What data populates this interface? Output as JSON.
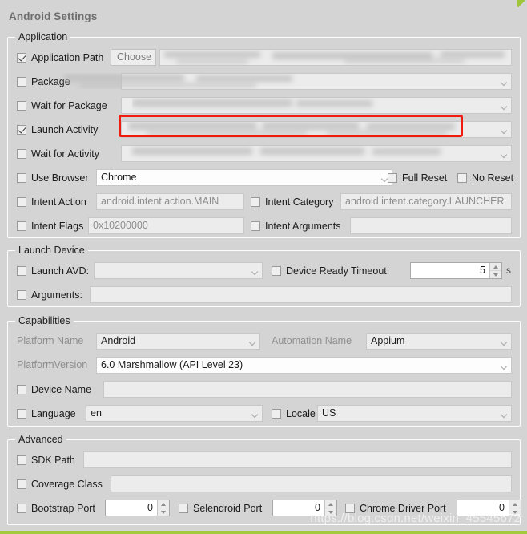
{
  "window": {
    "title": "Android Settings"
  },
  "watermark": "https://blog.csdn.net/weixin_45545672",
  "colors": {
    "background": "#d4d4d4",
    "highlight_border": "#f01c12",
    "accent_green": "#a3c93c",
    "field_background": "#ececec",
    "title_text": "#6e6e6e"
  },
  "groups": {
    "application": {
      "title": "Application",
      "rows": {
        "application_path": {
          "label": "Application Path",
          "checked": true,
          "button_label": "Choose",
          "value": ""
        },
        "package": {
          "label": "Package",
          "checked": false,
          "value": ""
        },
        "wait_for_package": {
          "label": "Wait for Package",
          "checked": false,
          "value": ""
        },
        "launch_activity": {
          "label": "Launch Activity",
          "checked": true,
          "value": "",
          "highlighted": true
        },
        "wait_for_activity": {
          "label": "Wait for Activity",
          "checked": false,
          "value": ""
        },
        "use_browser": {
          "label": "Use Browser",
          "checked": false,
          "value": "Chrome"
        },
        "full_reset": {
          "label": "Full Reset",
          "checked": false
        },
        "no_reset": {
          "label": "No Reset",
          "checked": false
        },
        "intent_action": {
          "label": "Intent Action",
          "checked": false,
          "value": "android.intent.action.MAIN"
        },
        "intent_category": {
          "label": "Intent Category",
          "checked": false,
          "value": "android.intent.category.LAUNCHER"
        },
        "intent_flags": {
          "label": "Intent Flags",
          "checked": false,
          "value": "0x10200000"
        },
        "intent_arguments": {
          "label": "Intent Arguments",
          "checked": false,
          "value": ""
        }
      }
    },
    "launch_device": {
      "title": "Launch Device",
      "rows": {
        "launch_avd": {
          "label": "Launch AVD:",
          "checked": false,
          "value": ""
        },
        "device_ready_timeout": {
          "label": "Device Ready Timeout:",
          "checked": false,
          "value": "5",
          "unit": "s"
        },
        "arguments": {
          "label": "Arguments:",
          "checked": false,
          "value": ""
        }
      }
    },
    "capabilities": {
      "title": "Capabilities",
      "rows": {
        "platform_name": {
          "label": "Platform Name",
          "value": "Android"
        },
        "automation_name": {
          "label": "Automation Name",
          "value": "Appium"
        },
        "platform_version": {
          "label": "PlatformVersion",
          "value": "6.0 Marshmallow (API Level 23)"
        },
        "device_name": {
          "label": "Device Name",
          "checked": false,
          "value": ""
        },
        "language": {
          "label": "Language",
          "checked": false,
          "value": "en"
        },
        "locale": {
          "label": "Locale",
          "checked": false,
          "value": "US"
        }
      }
    },
    "advanced": {
      "title": "Advanced",
      "rows": {
        "sdk_path": {
          "label": "SDK Path",
          "checked": false,
          "value": ""
        },
        "coverage_class": {
          "label": "Coverage Class",
          "checked": false,
          "value": ""
        },
        "bootstrap_port": {
          "label": "Bootstrap Port",
          "checked": false,
          "value": "0"
        },
        "selendroid_port": {
          "label": "Selendroid Port",
          "checked": false,
          "value": "0"
        },
        "chrome_driver_port": {
          "label": "Chrome Driver Port",
          "checked": false,
          "value": "0"
        }
      }
    }
  }
}
